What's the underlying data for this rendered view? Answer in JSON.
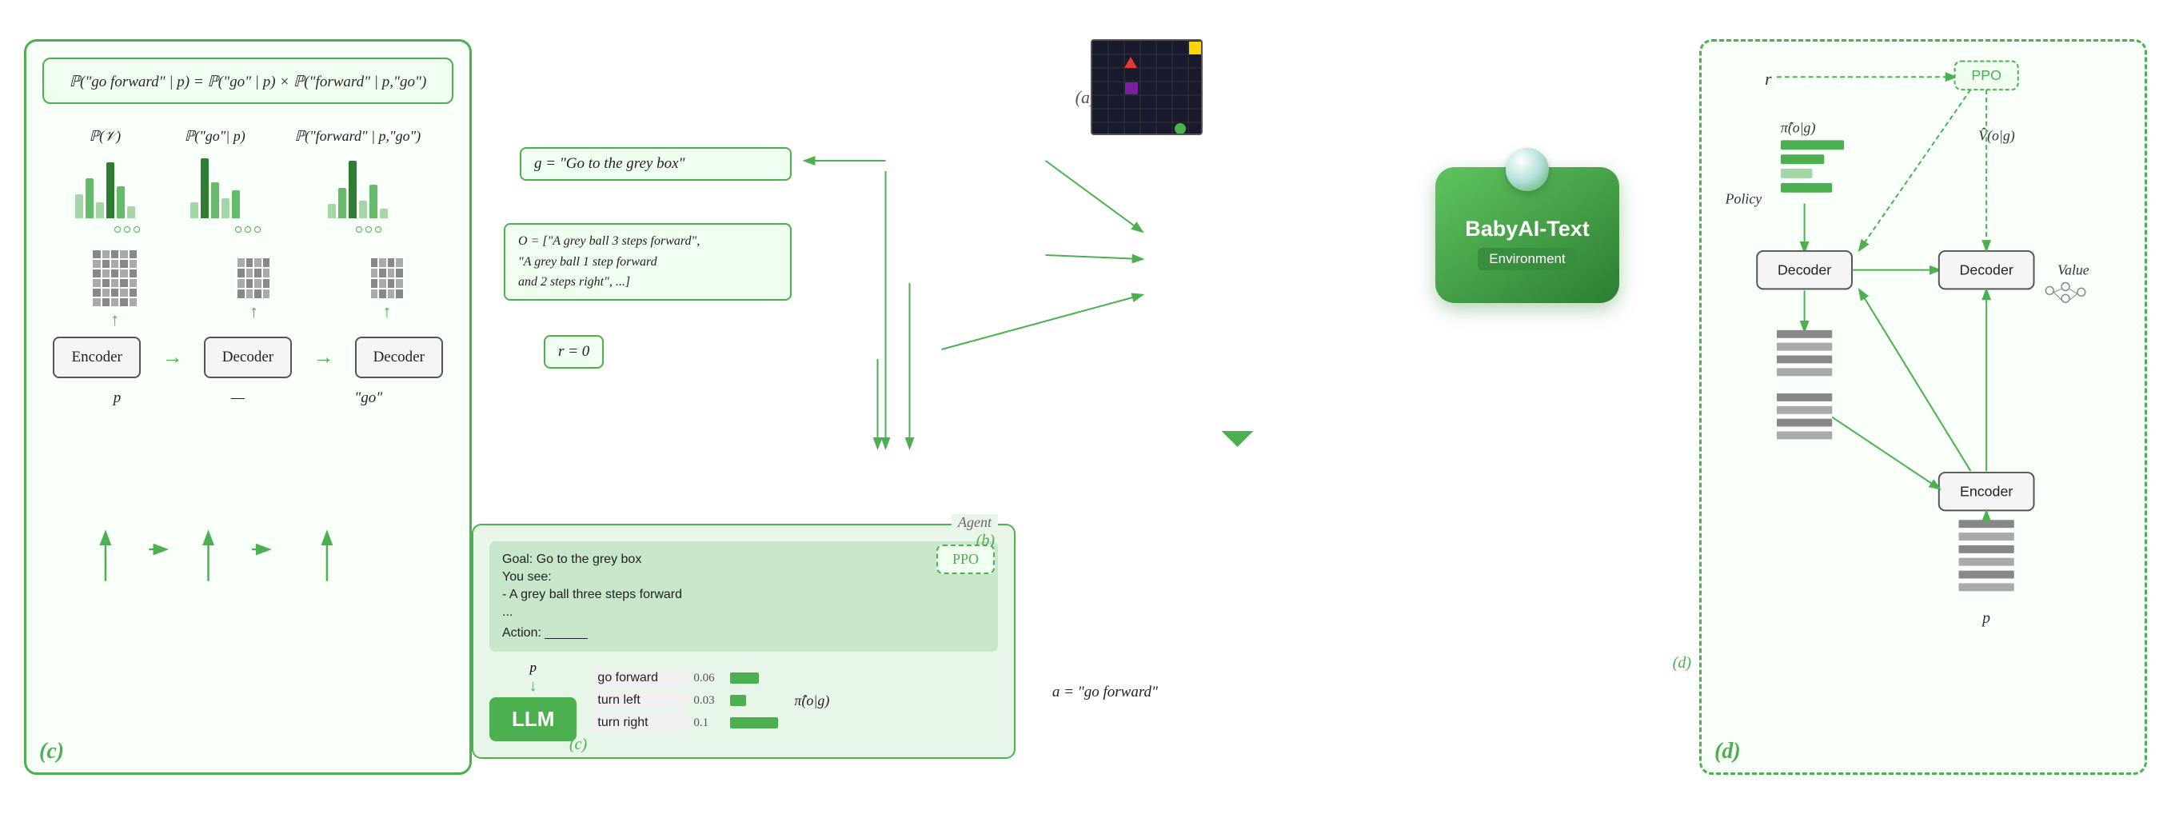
{
  "diagram": {
    "title_a": "(a)",
    "title_b": "(b)",
    "title_c": "(c)",
    "title_d": "(d)",
    "babyai_text": "BabyAI-Text",
    "environment_label": "Environment",
    "agent_label": "Agent",
    "ppo_label": "PPO",
    "llm_label": "LLM",
    "encoder_label": "Encoder",
    "decoder_label": "Decoder",
    "policy_label": "Policy",
    "value_label": "Value",
    "r_label": "r",
    "p_label": "p",
    "go_forward_label": "go forward",
    "turn_left_label": "turn left",
    "turn_right_label": "turn right",
    "go_forward_prob": "0.06",
    "turn_left_prob": "0.03",
    "turn_right_prob": "0.1",
    "a_equals": "a = \"go forward\"",
    "r_equals": "r = 0",
    "g_equals": "g = \"Go to the grey box\"",
    "o_equals": "O = [\"A grey ball 3 steps forward\", \"A grey ball 1 step forward and 2 steps right\", ...]",
    "agent_goal": "Goal: Go to the grey box",
    "agent_you_see": "You see:",
    "agent_observation": "- A grey ball three steps forward",
    "agent_dots": "...",
    "agent_action": "Action: ______",
    "formula_text": "ℙ(\"go forward\" | p) = ℙ(\"go\" | p) × ℙ(\"forward\" | p,\"go\")",
    "p_v_label": "ℙ(𝒱)",
    "prob_go_label": "ℙ(\"go\"| p)",
    "prob_forward_label": "ℙ(\"forward\" | p,\"go\")",
    "pi_og_label": "π̂(o|g)",
    "v_og_label": "V̂(o|g)"
  }
}
